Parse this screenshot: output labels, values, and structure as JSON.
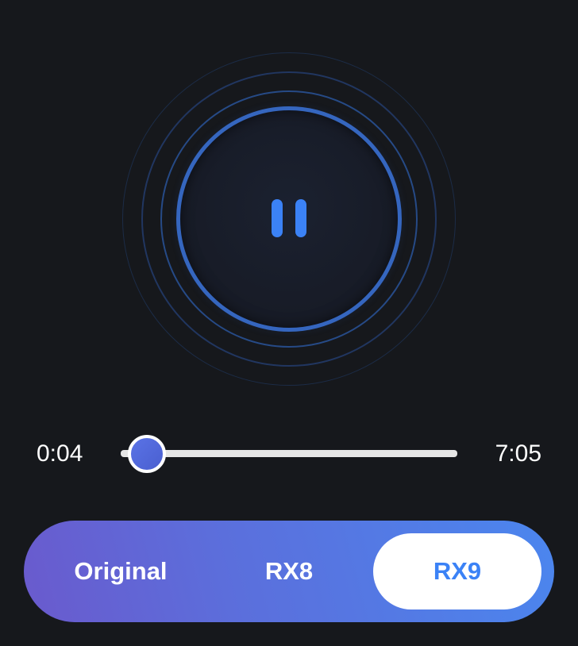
{
  "player": {
    "state": "playing",
    "button_icon": "pause-icon",
    "accent_color": "#3b82f6"
  },
  "progress": {
    "current_time": "0:04",
    "total_time": "7:05",
    "fraction": 0.0094
  },
  "mode_selector": {
    "options": [
      "Original",
      "RX8",
      "RX9"
    ],
    "selected": "RX9"
  }
}
